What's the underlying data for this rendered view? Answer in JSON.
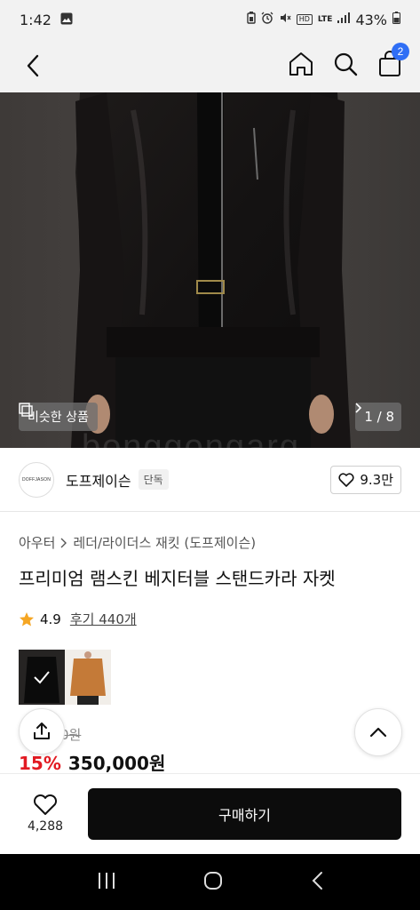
{
  "status_bar": {
    "time": "1:42",
    "battery_text": "43%",
    "lte_label": "LTE",
    "hd_label": "HD"
  },
  "top_nav": {
    "cart_count": "2"
  },
  "hero": {
    "similar_label": "비슷한 상품",
    "pager_text": "1 / 8",
    "watermark": "bonggongarg"
  },
  "brand": {
    "logo_text": "DOFFJASON",
    "name": "도프제이슨",
    "tag": "단독",
    "likes": "9.3만"
  },
  "breadcrumb": {
    "root": "아우터",
    "sub": "레더/라이더스 재킷 (도프제이슨)"
  },
  "product": {
    "title": "프리미엄 램스킨 베지터블 스탠드카라 자켓",
    "rating": "4.9",
    "reviews": "후기 440개",
    "original_price": "0원",
    "discount": "15%",
    "sale_price": "350,000원"
  },
  "bottom_bar": {
    "wish_count": "4,288",
    "buy_label": "구매하기"
  },
  "colors": {
    "accent_blue": "#2f6ef5",
    "discount_red": "#e21a22",
    "star": "#f5a623",
    "buy_button": "#0c0c0c"
  }
}
